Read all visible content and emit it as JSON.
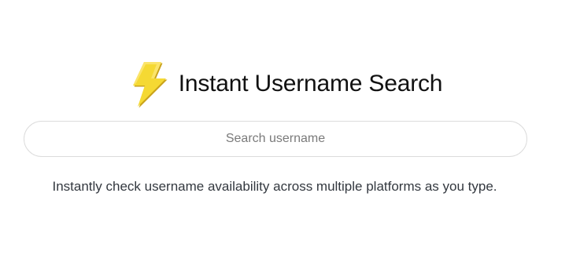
{
  "header": {
    "icon": "lightning-bolt-icon",
    "title": "Instant Username Search"
  },
  "search": {
    "placeholder": "Search username",
    "value": ""
  },
  "tagline": "Instantly check username availability across multiple platforms as you type.",
  "colors": {
    "bolt_fill": "#f5d933",
    "bolt_shadow": "#c9a21a",
    "border": "#dcdcdc",
    "text": "#33383f"
  }
}
